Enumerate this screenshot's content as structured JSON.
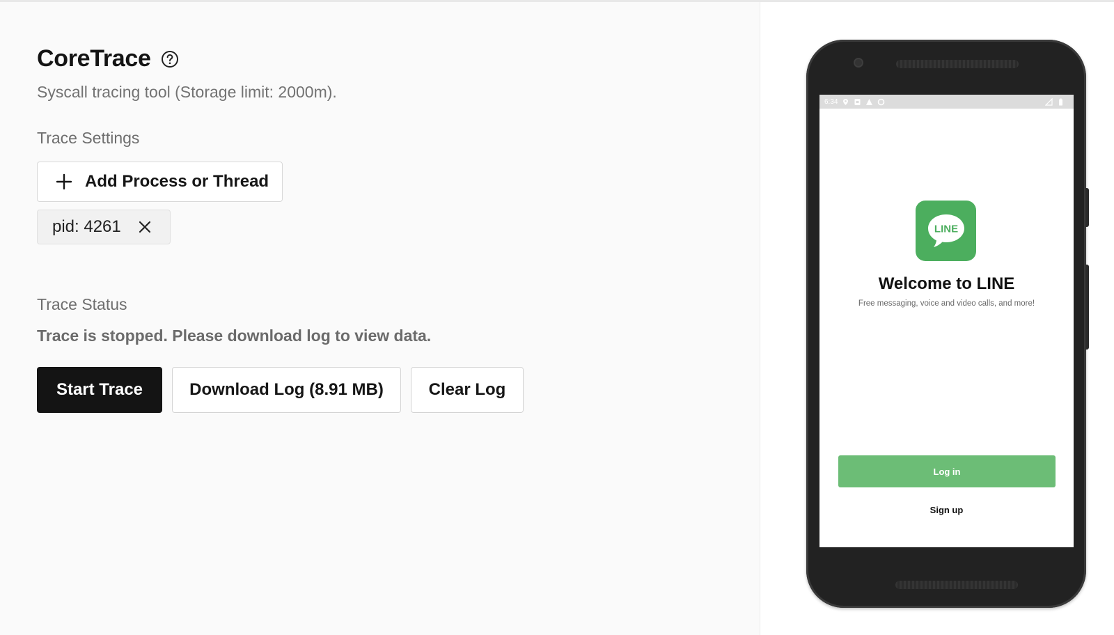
{
  "app": {
    "title": "CoreTrace",
    "subtitle": "Syscall tracing tool (Storage limit: 2000m).",
    "help_icon": "help-circle-icon"
  },
  "trace_settings": {
    "label": "Trace Settings",
    "add_button_label": "Add Process or Thread",
    "add_icon": "plus-icon",
    "targets": [
      {
        "label": "pid: 4261",
        "remove_icon": "close-icon"
      }
    ]
  },
  "trace_status": {
    "label": "Trace Status",
    "message": "Trace is stopped. Please download log to view data."
  },
  "actions": {
    "start_label": "Start Trace",
    "download_label": "Download Log (8.91 MB)",
    "clear_label": "Clear Log"
  },
  "device": {
    "status_bar": {
      "time": "6:34"
    },
    "app_screen": {
      "logo_text": "LINE",
      "welcome": "Welcome to LINE",
      "tagline": "Free messaging, voice and video calls, and more!",
      "login_label": "Log in",
      "signup_label": "Sign up",
      "brand_color": "#4cae5e",
      "login_color": "#6cbd76"
    }
  }
}
